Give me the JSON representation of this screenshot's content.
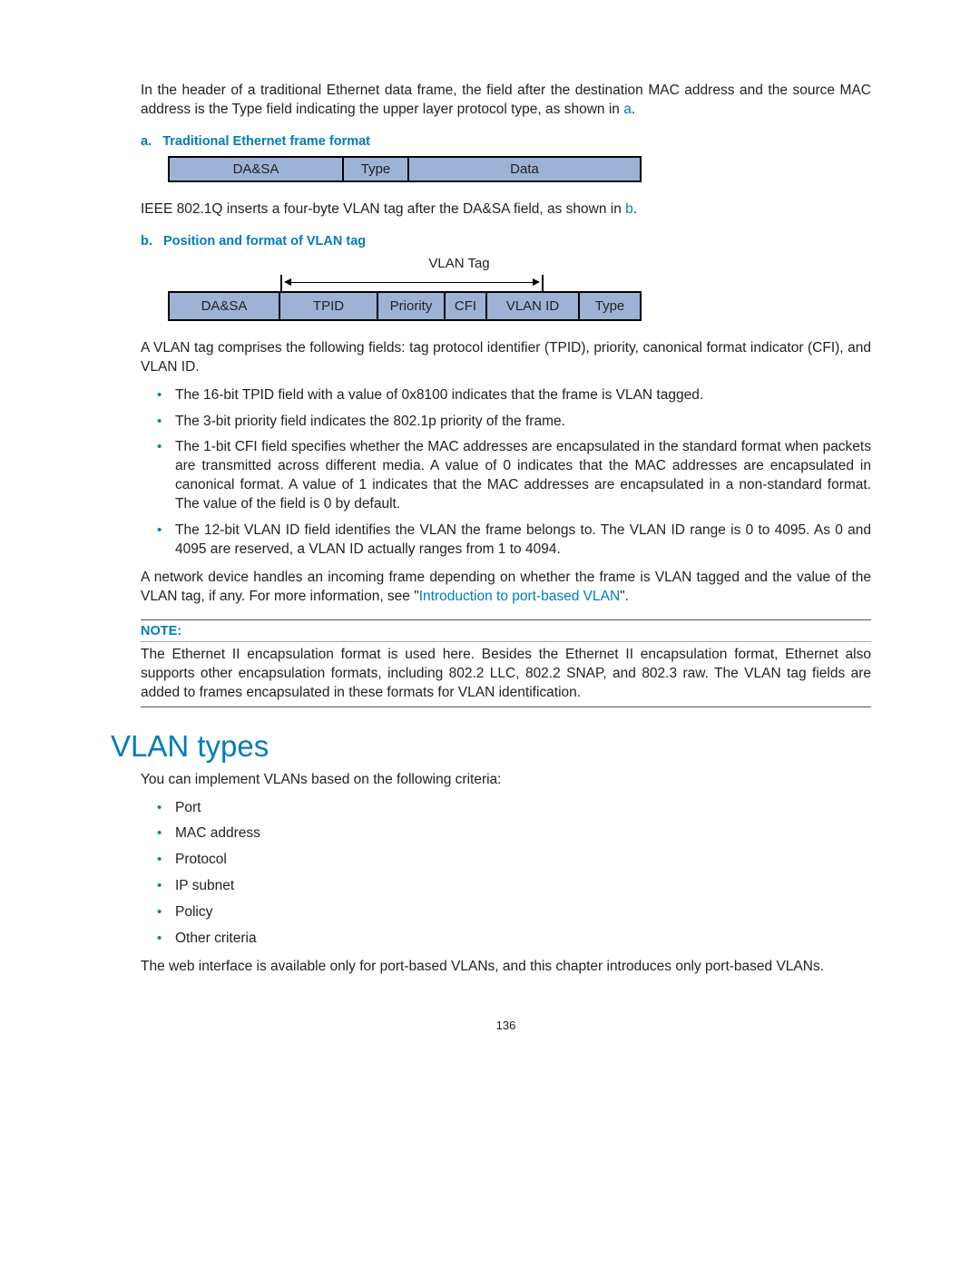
{
  "intro": {
    "p1_a": "In the header of a traditional Ethernet data frame, the field after the destination MAC address and the source MAC address is the Type field indicating the upper layer protocol type, as shown in ",
    "p1_link": "a",
    "p1_b": "."
  },
  "fig_a": {
    "caption_prefix": "a.",
    "caption_text": "Traditional Ethernet frame format",
    "cells": {
      "dasa": "DA&SA",
      "type": "Type",
      "data": "Data"
    }
  },
  "p2_a": "IEEE 802.1Q inserts a four-byte VLAN tag after the DA&SA field, as shown in ",
  "p2_link": "b",
  "p2_b": ".",
  "fig_b": {
    "caption_prefix": "b.",
    "caption_text": "Position and format of VLAN tag",
    "label": "VLAN Tag",
    "cells": {
      "dasa": "DA&SA",
      "tpid": "TPID",
      "priority": "Priority",
      "cfi": "CFI",
      "vlanid": "VLAN ID",
      "type": "Type"
    }
  },
  "p3": "A VLAN tag comprises the following fields: tag protocol identifier (TPID), priority, canonical format indicator (CFI), and VLAN ID.",
  "bullets1": [
    "The 16-bit TPID field with a value of 0x8100 indicates that the frame is VLAN tagged.",
    "The 3-bit priority field indicates the 802.1p priority of the frame.",
    "The 1-bit CFI field specifies whether the MAC addresses are encapsulated in the standard format when packets are transmitted across different media. A value of 0 indicates that the MAC addresses are encapsulated in canonical format. A value of 1 indicates that the MAC addresses are encapsulated in a non-standard format. The value of the field is 0 by default.",
    "The 12-bit VLAN ID field identifies the VLAN the frame belongs to. The VLAN ID range is 0 to 4095. As 0 and 4095 are reserved, a VLAN ID actually ranges from 1 to 4094."
  ],
  "p4_a": "A network device handles an incoming frame depending on whether the frame is VLAN tagged and the value of the VLAN tag, if any. For more information, see \"",
  "p4_link": "Introduction to port-based VLAN",
  "p4_b": "\".",
  "note": {
    "label": "NOTE:",
    "body": "The Ethernet II encapsulation format is used here. Besides the Ethernet II encapsulation format, Ethernet also supports other encapsulation formats, including 802.2 LLC, 802.2 SNAP, and 802.3 raw. The VLAN tag fields are added to frames encapsulated in these formats for VLAN identification."
  },
  "section2": {
    "heading": "VLAN types",
    "intro": "You can implement VLANs based on the following criteria:",
    "items": [
      "Port",
      "MAC address",
      "Protocol",
      "IP subnet",
      "Policy",
      "Other criteria"
    ],
    "outro": "The web interface is available only for port-based VLANs, and this chapter introduces only port-based VLANs."
  },
  "page_number": "136"
}
